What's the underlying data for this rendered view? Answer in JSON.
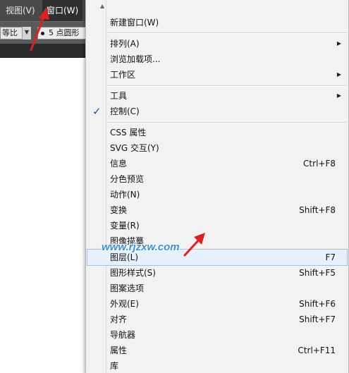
{
  "menubar": {
    "view_label": "视图(V)",
    "window_label": "窗口(W)"
  },
  "controlbar": {
    "ratio_value": "等比",
    "brush_value": "5 点圆形"
  },
  "menu": {
    "items": [
      {
        "label": "新建窗口(W)",
        "shortcut": "",
        "submenu": false,
        "checked": false
      },
      {
        "label": "排列(A)",
        "shortcut": "",
        "submenu": true,
        "checked": false
      },
      {
        "label": "浏览加载项...",
        "shortcut": "",
        "submenu": false,
        "checked": false
      },
      {
        "label": "工作区",
        "shortcut": "",
        "submenu": true,
        "checked": false
      },
      {
        "label": "工具",
        "shortcut": "",
        "submenu": true,
        "checked": false
      },
      {
        "label": "控制(C)",
        "shortcut": "",
        "submenu": false,
        "checked": true
      },
      {
        "label": "CSS 属性",
        "shortcut": "",
        "submenu": false,
        "checked": false
      },
      {
        "label": "SVG 交互(Y)",
        "shortcut": "",
        "submenu": false,
        "checked": false
      },
      {
        "label": "信息",
        "shortcut": "Ctrl+F8",
        "submenu": false,
        "checked": false
      },
      {
        "label": "分色预览",
        "shortcut": "",
        "submenu": false,
        "checked": false
      },
      {
        "label": "动作(N)",
        "shortcut": "",
        "submenu": false,
        "checked": false
      },
      {
        "label": "变换",
        "shortcut": "Shift+F8",
        "submenu": false,
        "checked": false
      },
      {
        "label": "变量(R)",
        "shortcut": "",
        "submenu": false,
        "checked": false
      },
      {
        "label": "图像描摹",
        "shortcut": "",
        "submenu": false,
        "checked": false
      },
      {
        "label": "图层(L)",
        "shortcut": "F7",
        "submenu": false,
        "checked": false
      },
      {
        "label": "图形样式(S)",
        "shortcut": "Shift+F5",
        "submenu": false,
        "checked": false
      },
      {
        "label": "图案选项",
        "shortcut": "",
        "submenu": false,
        "checked": false
      },
      {
        "label": "外观(E)",
        "shortcut": "Shift+F6",
        "submenu": false,
        "checked": false
      },
      {
        "label": "对齐",
        "shortcut": "Shift+F7",
        "submenu": false,
        "checked": false
      },
      {
        "label": "导航器",
        "shortcut": "",
        "submenu": false,
        "checked": false
      },
      {
        "label": "属性",
        "shortcut": "Ctrl+F11",
        "submenu": false,
        "checked": false
      },
      {
        "label": "库",
        "shortcut": "",
        "submenu": false,
        "checked": false
      }
    ]
  },
  "watermark": "www.rjzxw.com",
  "colors": {
    "accent": "#1a55b0",
    "highlight": "#e8f1fb",
    "arrow": "#e02020"
  }
}
